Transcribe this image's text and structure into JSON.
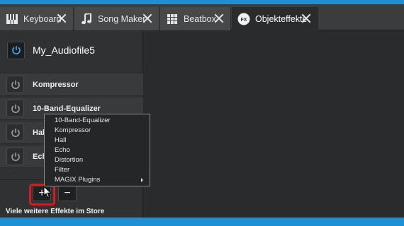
{
  "tabs": [
    {
      "label": "Keyboard",
      "icon": "piano-keys-icon"
    },
    {
      "label": "Song Maker",
      "icon": "music-note-icon"
    },
    {
      "label": "Beatbox",
      "icon": "grid-pads-icon"
    },
    {
      "label": "Objekteffekte",
      "icon": "fx-icon",
      "badge": "FX"
    }
  ],
  "panel": {
    "title": "My_Audiofile5",
    "effects": [
      {
        "label": "Kompressor"
      },
      {
        "label": "10-Band-Equalizer"
      },
      {
        "label": "Hall"
      },
      {
        "label": "Echo"
      }
    ],
    "add_label": "+",
    "remove_label": "−",
    "store_text": "Viele weitere Effekte im Store"
  },
  "menu": {
    "items": [
      {
        "label": "10-Band-Equalizer"
      },
      {
        "label": "Kompressor"
      },
      {
        "label": "Hall"
      },
      {
        "label": "Echo"
      },
      {
        "label": "Distortion"
      },
      {
        "label": "Filter"
      },
      {
        "label": "MAGIX Plugins",
        "submenu": true
      }
    ]
  },
  "colors": {
    "frame": "#1e8fd4",
    "highlight": "#e5141a",
    "power_active": "#3fa9f5"
  }
}
